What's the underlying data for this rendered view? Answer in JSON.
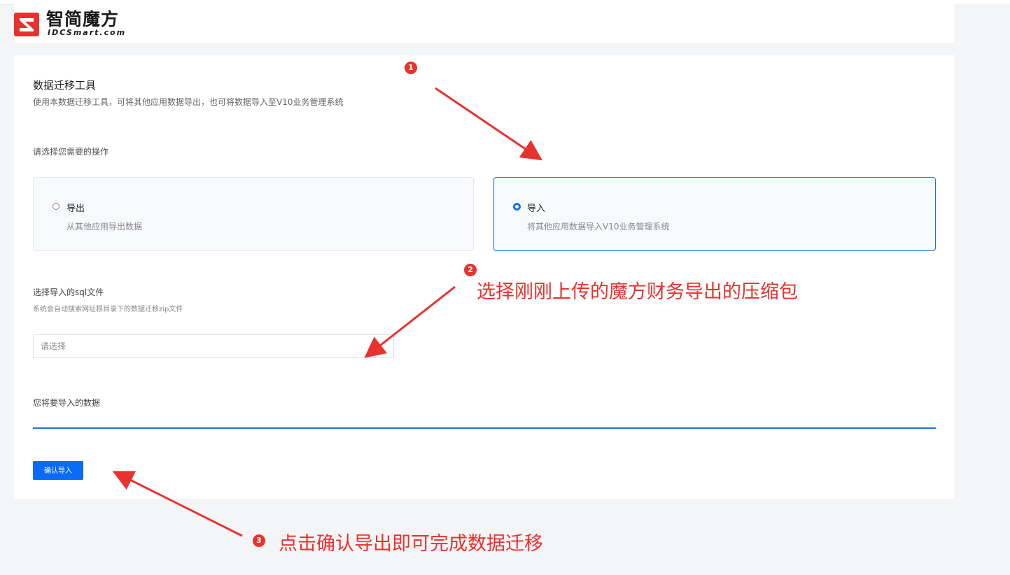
{
  "header": {
    "logo_cn": "智简魔方",
    "logo_en": "IDCSmart.com"
  },
  "tool": {
    "title": "数据迁移工具",
    "subtitle": "使用本数据迁移工具，可将其他应用数据导出，也可将数据导入至V10业务管理系统",
    "prompt": "请选择您需要的操作"
  },
  "options": [
    {
      "label": "导出",
      "desc": "从其他应用导出数据",
      "selected": false
    },
    {
      "label": "导入",
      "desc": "将其他应用数据导入V10业务管理系统",
      "selected": true
    }
  ],
  "file": {
    "title": "选择导入的sql文件",
    "hint": "系统会自动搜索网址根目录下的数据迁移zip文件",
    "placeholder": "请选择"
  },
  "data_section": {
    "title": "您将要导入的数据"
  },
  "actions": {
    "confirm_label": "确认导入"
  },
  "annotations": {
    "color": "#e8322e",
    "badges": [
      "1",
      "2",
      "3"
    ],
    "step2_text": "选择刚刚上传的魔方财务导出的压缩包",
    "step3_text": "点击确认导出即可完成数据迁移"
  },
  "colors": {
    "accent": "#1a73e8",
    "button": "#0a6cf5",
    "logo_red": "#e8322e"
  }
}
